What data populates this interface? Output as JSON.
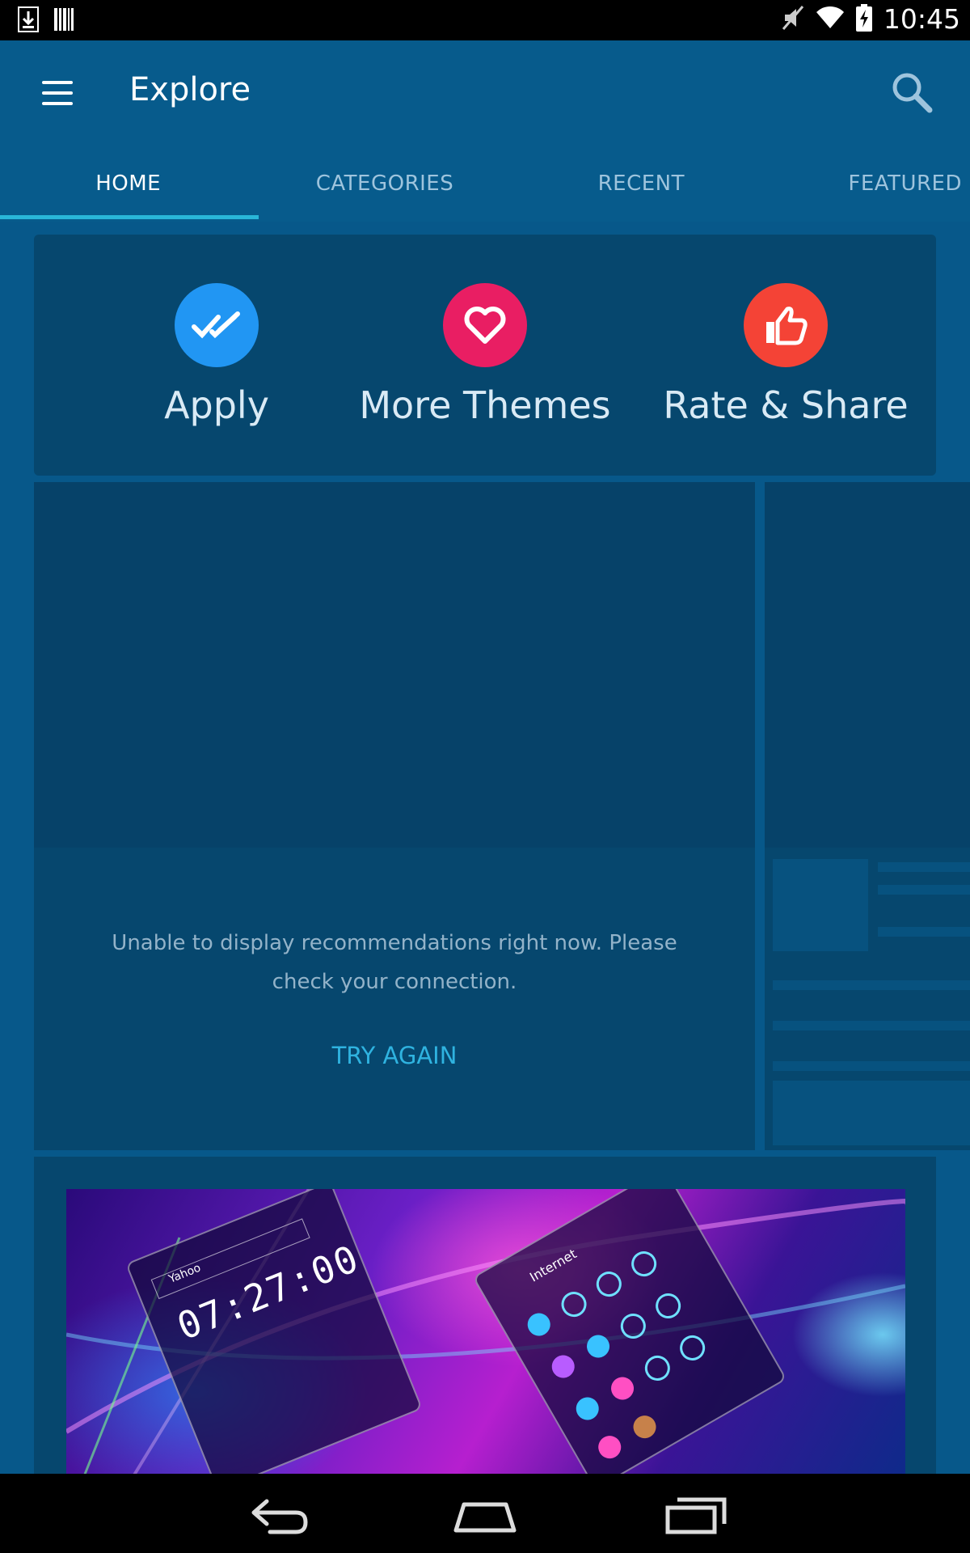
{
  "status_bar": {
    "time": "10:45",
    "icons": [
      "download-icon",
      "barcode-icon",
      "mute-icon",
      "wifi-icon",
      "battery-charging-icon"
    ]
  },
  "app_bar": {
    "title": "Explore",
    "menu_icon": "menu-icon",
    "search_icon": "search-icon"
  },
  "tabs": [
    {
      "label": "HOME",
      "active": true
    },
    {
      "label": "CATEGORIES",
      "active": false
    },
    {
      "label": "RECENT",
      "active": false
    },
    {
      "label": "FEATURED",
      "active": false
    }
  ],
  "actions": [
    {
      "label": "Apply",
      "icon": "double-check-icon",
      "color": "#2196f3"
    },
    {
      "label": "More Themes",
      "icon": "heart-icon",
      "color": "#e91e63"
    },
    {
      "label": "Rate & Share",
      "icon": "thumbs-up-icon",
      "color": "#f44336"
    }
  ],
  "recommendations": {
    "message": "Unable to display recommendations right now. Please check your connection.",
    "retry_label": "TRY AGAIN"
  },
  "banner": {
    "clock_text": "07:27:00",
    "search_text": "Yahoo",
    "header_text": "Internet"
  },
  "nav_bar": {
    "icons": [
      "back-icon",
      "home-icon",
      "recents-icon"
    ]
  },
  "colors": {
    "background": "#07588a",
    "card": "#06476e",
    "accent": "#29b6d8"
  }
}
